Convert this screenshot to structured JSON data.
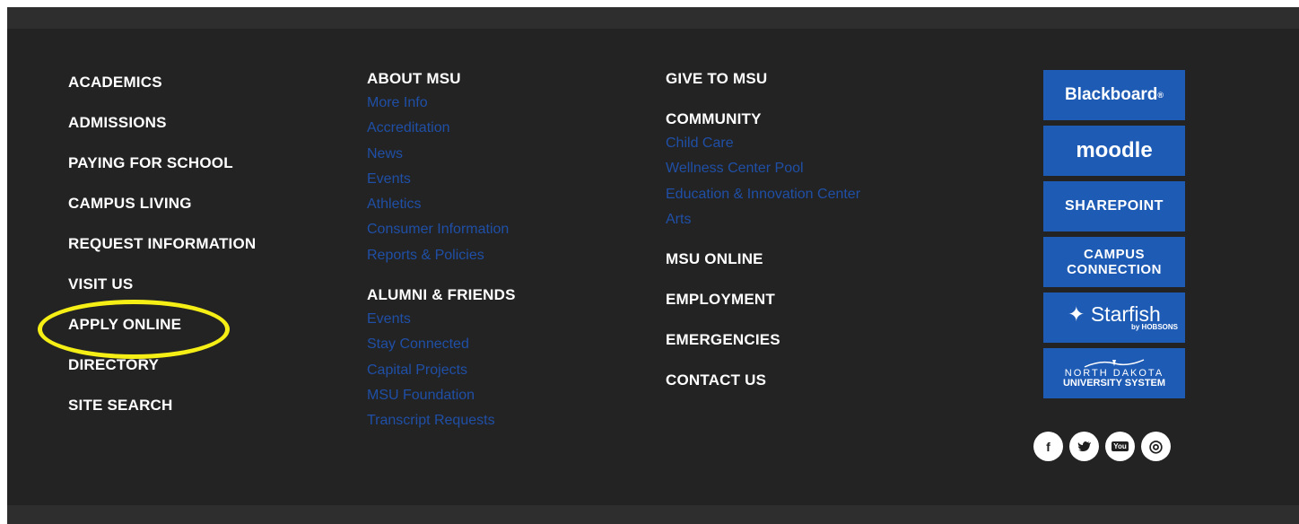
{
  "col1": {
    "items": [
      "ACADEMICS",
      "ADMISSIONS",
      "PAYING FOR SCHOOL",
      "CAMPUS LIVING",
      "REQUEST INFORMATION",
      "VISIT US",
      "APPLY ONLINE",
      "DIRECTORY",
      "SITE SEARCH"
    ]
  },
  "col2": {
    "about": {
      "heading": "ABOUT MSU",
      "links": [
        "More Info",
        "Accreditation",
        "News",
        "Events",
        "Athletics",
        "Consumer Information",
        "Reports & Policies"
      ]
    },
    "alumni": {
      "heading": "ALUMNI & FRIENDS",
      "links": [
        "Events",
        "Stay Connected",
        "Capital Projects",
        "MSU Foundation",
        "Transcript Requests"
      ]
    }
  },
  "col3": {
    "give": "GIVE TO MSU",
    "community": {
      "heading": "COMMUNITY",
      "links": [
        "Child Care",
        "Wellness Center Pool",
        "Education & Innovation Center",
        "Arts"
      ]
    },
    "more": [
      "MSU ONLINE",
      "EMPLOYMENT",
      "EMERGENCIES",
      "CONTACT US"
    ]
  },
  "quick_links": {
    "blackboard": "Blackboard",
    "blackboard_reg": "®",
    "moodle": "moodle",
    "sharepoint": "SHAREPOINT",
    "campus_connection_1": "CAMPUS",
    "campus_connection_2": "CONNECTION",
    "starfish": "Starfish",
    "starfish_by": "by HOBSONS",
    "ndus_1": "NORTH DAKOTA",
    "ndus_2": "UNIVERSITY SYSTEM"
  },
  "social": {
    "facebook": "f",
    "twitter": "t",
    "youtube": "You",
    "instagram": "◎"
  },
  "colors": {
    "background": "#232323",
    "link_blue": "#1f4fa6",
    "tile_blue": "#1e5bb4",
    "highlight": "#f6ef16"
  }
}
